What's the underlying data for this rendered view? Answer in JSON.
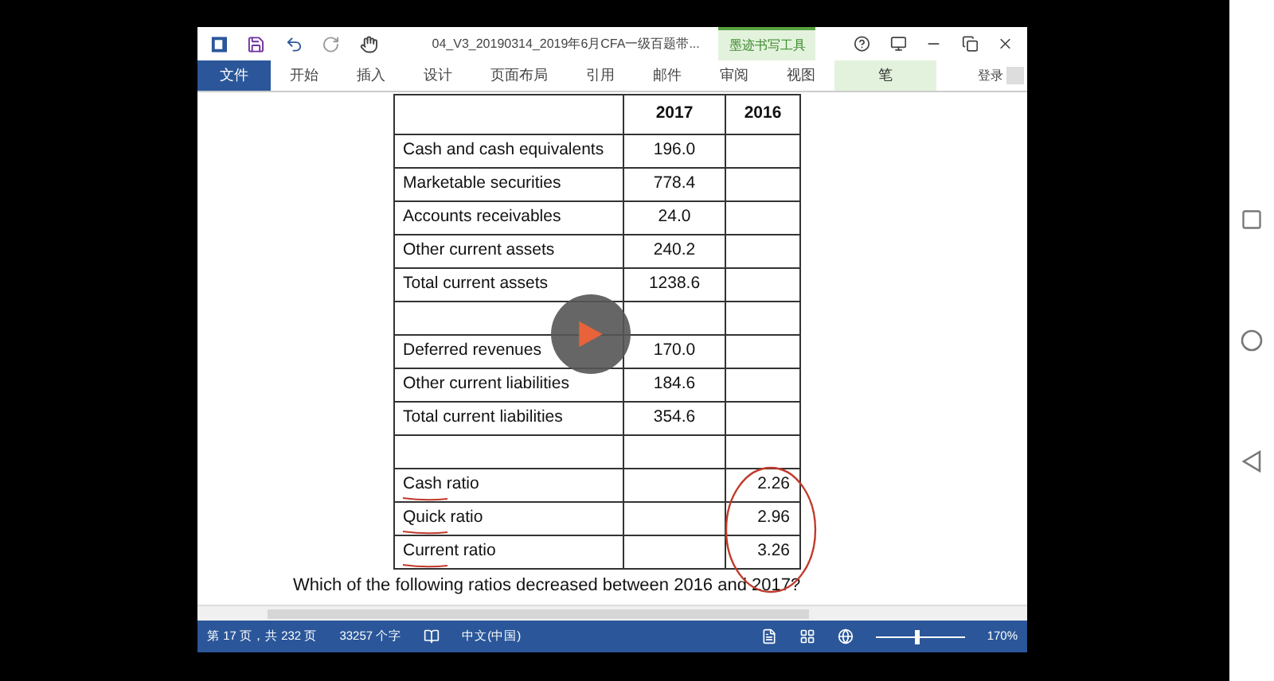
{
  "window": {
    "title": "04_V3_20190314_2019年6月CFA一级百题带...",
    "contextual_tab": "墨迹书写工具",
    "sign_in": "登录"
  },
  "ribbon_tabs": [
    {
      "label": "文件",
      "kind": "file",
      "selected": false
    },
    {
      "label": "开始",
      "kind": "tab",
      "selected": false
    },
    {
      "label": "插入",
      "kind": "tab",
      "selected": false
    },
    {
      "label": "设计",
      "kind": "tab",
      "selected": false
    },
    {
      "label": "页面布局",
      "kind": "tab",
      "selected": false
    },
    {
      "label": "引用",
      "kind": "tab",
      "selected": false
    },
    {
      "label": "邮件",
      "kind": "tab",
      "selected": false
    },
    {
      "label": "审阅",
      "kind": "tab",
      "selected": false
    },
    {
      "label": "视图",
      "kind": "tab",
      "selected": false
    },
    {
      "label": "笔",
      "kind": "contextual",
      "selected": false
    }
  ],
  "table": {
    "columns": [
      "2017",
      "2016"
    ],
    "rows": [
      {
        "label": "Cash and cash equivalents",
        "v2017": "196.0"
      },
      {
        "label": "Marketable securities",
        "v2017": "778.4"
      },
      {
        "label": "Accounts receivables",
        "v2017": "24.0"
      },
      {
        "label": "Other current assets",
        "v2017": "240.2"
      },
      {
        "label": "Total current assets",
        "v2017": "1238.6"
      },
      {},
      {
        "label": "Deferred revenues",
        "v2017": "170.0"
      },
      {
        "label": "Other current liabilities",
        "v2017": "184.6"
      },
      {
        "label": "Total current liabilities",
        "v2017": "354.6"
      },
      {},
      {
        "label": "Cash ratio",
        "v2016": "2.26",
        "underlined": true
      },
      {
        "label": "Quick ratio",
        "v2016": "2.96",
        "underlined": true
      },
      {
        "label": "Current ratio",
        "v2016": "3.26",
        "underlined": true
      }
    ]
  },
  "question": "Which of the following ratios decreased between 2016 and 2017?",
  "status_bar": {
    "page": "第 17 页，共 232 页",
    "words": "33257 个字",
    "language": "中文(中国)",
    "zoom": {
      "level": 0.47,
      "reading": "170%"
    }
  }
}
